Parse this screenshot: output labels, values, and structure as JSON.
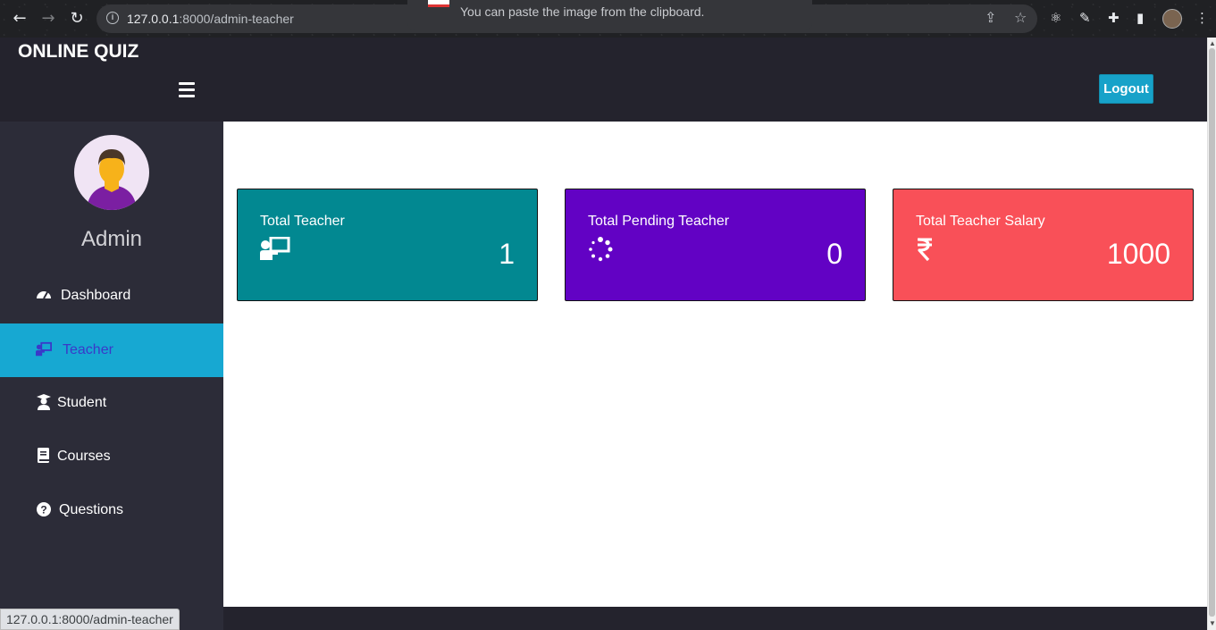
{
  "browser": {
    "url_host": "127.0.0.1",
    "url_path": ":8000/admin-teacher",
    "notification": "You can paste the image from the clipboard.",
    "status_url": "127.0.0.1:8000/admin-teacher"
  },
  "header": {
    "brand": "ONLINE QUIZ",
    "logout_label": "Logout"
  },
  "sidebar": {
    "user_name": "Admin",
    "items": [
      {
        "label": "Dashboard",
        "icon": "tachometer-icon",
        "active": false
      },
      {
        "label": "Teacher",
        "icon": "chalkboard-teacher-icon",
        "active": true
      },
      {
        "label": "Student",
        "icon": "user-graduate-icon",
        "active": false
      },
      {
        "label": "Courses",
        "icon": "book-icon",
        "active": false
      },
      {
        "label": "Questions",
        "icon": "question-circle-icon",
        "active": false
      }
    ]
  },
  "cards": [
    {
      "title": "Total Teacher",
      "value": "1",
      "icon": "chalkboard-teacher-icon",
      "color": "#028891"
    },
    {
      "title": "Total Pending Teacher",
      "value": "0",
      "icon": "spinner-icon",
      "color": "#6202c4"
    },
    {
      "title": "Total Teacher Salary",
      "value": "1000",
      "icon": "rupee-icon",
      "color": "#f95058"
    }
  ]
}
